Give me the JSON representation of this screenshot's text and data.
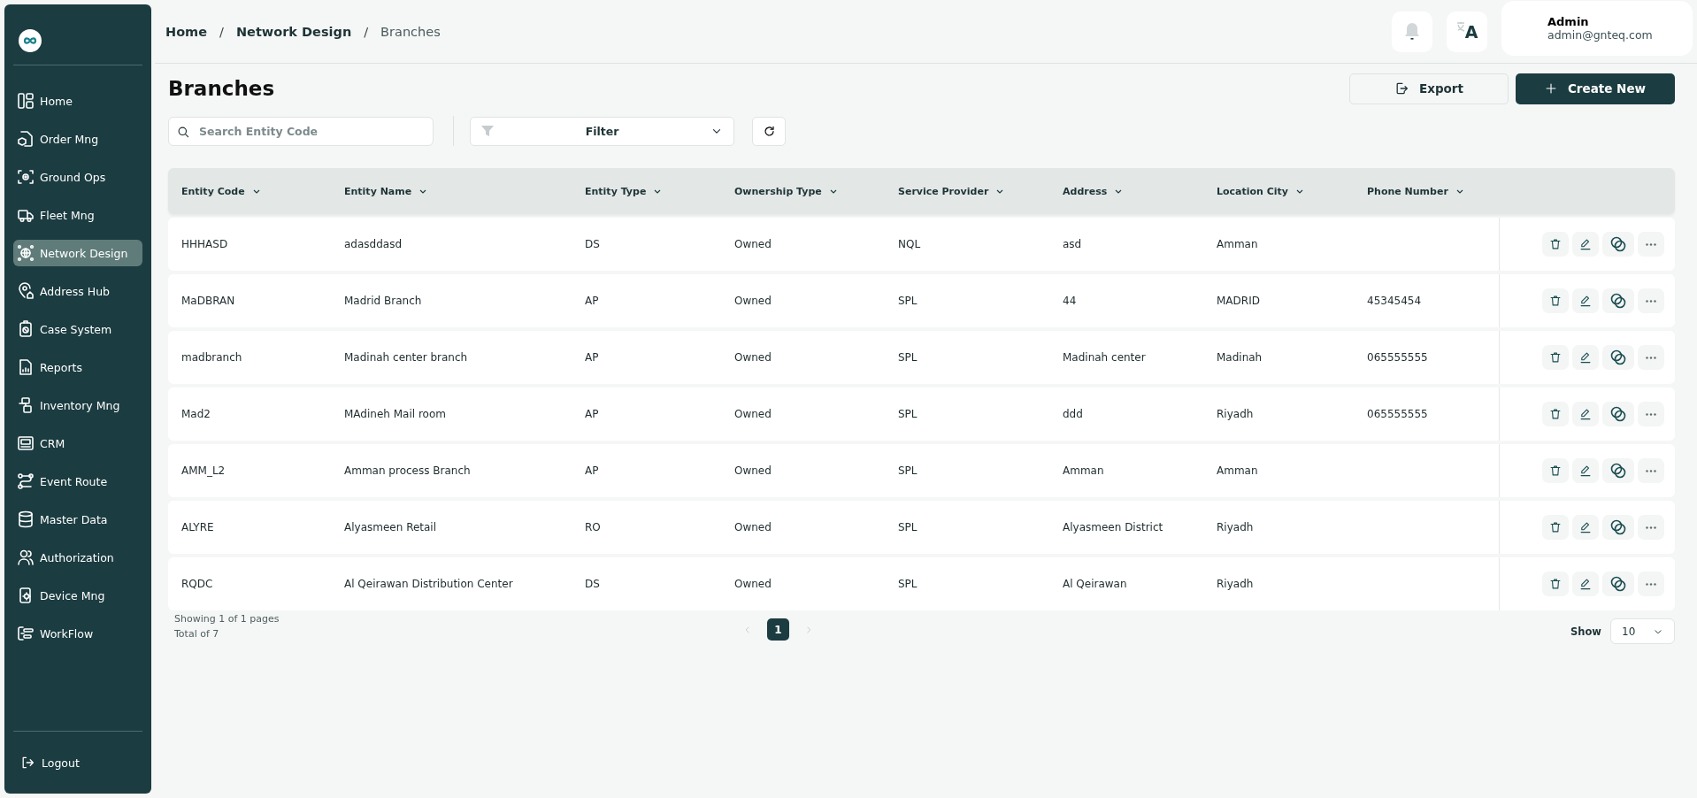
{
  "sidebar": {
    "items": [
      {
        "label": "Home",
        "selected": false
      },
      {
        "label": "Order Mng",
        "selected": false
      },
      {
        "label": "Ground Ops",
        "selected": false
      },
      {
        "label": "Fleet Mng",
        "selected": false
      },
      {
        "label": "Network Design",
        "selected": true
      },
      {
        "label": "Address Hub",
        "selected": false
      },
      {
        "label": "Case System",
        "selected": false
      },
      {
        "label": "Reports",
        "selected": false
      },
      {
        "label": "Inventory Mng",
        "selected": false
      },
      {
        "label": "CRM",
        "selected": false
      },
      {
        "label": "Event Route",
        "selected": false
      },
      {
        "label": "Master Data",
        "selected": false
      },
      {
        "label": "Authorization",
        "selected": false
      },
      {
        "label": "Device Mng",
        "selected": false
      },
      {
        "label": "WorkFlow",
        "selected": false
      }
    ],
    "logout": "Logout"
  },
  "header": {
    "breadcrumb": [
      {
        "label": "Home",
        "kind": "link"
      },
      {
        "label": "/",
        "kind": "separator"
      },
      {
        "label": "Network Design",
        "kind": "link"
      },
      {
        "label": "/",
        "kind": "separator"
      },
      {
        "label": "Branches",
        "kind": "current"
      }
    ],
    "translate_label": "A",
    "user": {
      "name": "Admin",
      "email": "admin@gnteq.com"
    }
  },
  "page": {
    "title": "Branches",
    "export": "Export",
    "create": "Create New"
  },
  "toolbar": {
    "search": {
      "placeholder": "Search Entity Code"
    },
    "filter": {
      "label": "Filter"
    }
  },
  "table": {
    "columns": [
      "Entity Code",
      "Entity Name",
      "Entity Type",
      "Ownership Type",
      "Service Provider",
      "Address",
      "Location City",
      "Phone Number"
    ],
    "rows": [
      {
        "entity_code": "HHHASD",
        "entity_name": "adasddasd",
        "entity_type": "DS",
        "ownership_type": "Owned",
        "service_provider": "NQL",
        "address": "asd",
        "location_city": "Amman"
      },
      {
        "entity_code": "MaDBRAN",
        "entity_name": "Madrid Branch",
        "entity_type": "AP",
        "ownership_type": "Owned",
        "service_provider": "SPL",
        "address": "44",
        "location_city": "MADRID",
        "phone_number": "45345454"
      },
      {
        "entity_code": "madbranch",
        "entity_name": "Madinah center branch",
        "entity_type": "AP",
        "ownership_type": "Owned",
        "service_provider": "SPL",
        "address": "Madinah center",
        "location_city": "Madinah",
        "phone_number": "065555555"
      },
      {
        "entity_code": "Mad2",
        "entity_name": "MAdineh Mail room",
        "entity_type": "AP",
        "ownership_type": "Owned",
        "service_provider": "SPL",
        "address": "ddd",
        "location_city": "Riyadh",
        "phone_number": "065555555"
      },
      {
        "entity_code": "AMM_L2",
        "entity_name": "Amman process Branch",
        "entity_type": "AP",
        "ownership_type": "Owned",
        "service_provider": "SPL",
        "address": "Amman",
        "location_city": "Amman"
      },
      {
        "entity_code": "ALYRE",
        "entity_name": "Alyasmeen Retail",
        "entity_type": "RO",
        "ownership_type": "Owned",
        "service_provider": "SPL",
        "address": "Alyasmeen District",
        "location_city": "Riyadh"
      },
      {
        "entity_code": "RQDC",
        "entity_name": "Al Qeirawan Distribution Center",
        "entity_type": "DS",
        "ownership_type": "Owned",
        "service_provider": "SPL",
        "address": "Al Qeirawan",
        "location_city": "Riyadh"
      }
    ]
  },
  "footer": {
    "showing": "Showing 1 of 1 pages",
    "total": "Total of 7",
    "prev": {
      "disabled": true
    },
    "pages": [
      {
        "label": "1",
        "selected": true
      }
    ],
    "next": {
      "disabled": true
    },
    "page_size": {
      "label": "Show",
      "value": "10"
    }
  }
}
